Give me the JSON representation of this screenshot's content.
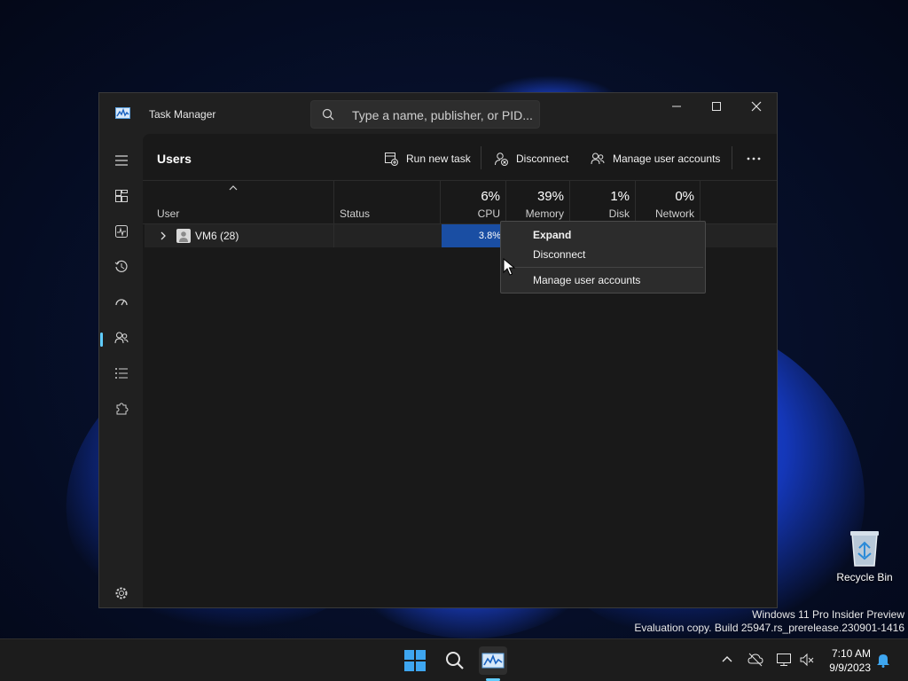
{
  "window": {
    "title": "Task Manager",
    "search_placeholder": "Type a name, publisher, or PID..."
  },
  "page": {
    "title": "Users"
  },
  "commands": {
    "run_new_task": "Run new task",
    "disconnect": "Disconnect",
    "manage_user_accounts": "Manage user accounts"
  },
  "table": {
    "columns": {
      "user": "User",
      "status": "Status",
      "cpu_pct": "6%",
      "cpu": "CPU",
      "memory_pct": "39%",
      "memory": "Memory",
      "disk_pct": "1%",
      "disk": "Disk",
      "network_pct": "0%",
      "network": "Network"
    },
    "rows": [
      {
        "user": "VM6 (28)",
        "status": "",
        "cpu": "3.8%"
      }
    ]
  },
  "context_menu": {
    "items": [
      "Expand",
      "Disconnect",
      "Manage user accounts"
    ]
  },
  "desktop": {
    "recycle_bin": "Recycle Bin",
    "watermark_line1": "Windows 11 Pro Insider Preview",
    "watermark_line2": "Evaluation copy. Build 25947.rs_prerelease.230901-1416"
  },
  "clock": {
    "time": "7:10 AM",
    "date": "9/9/2023"
  },
  "colors": {
    "accent": "#60cdff",
    "cpu_highlight": "#1a4ea3",
    "window_bg": "#202020",
    "content_bg": "#191919"
  }
}
